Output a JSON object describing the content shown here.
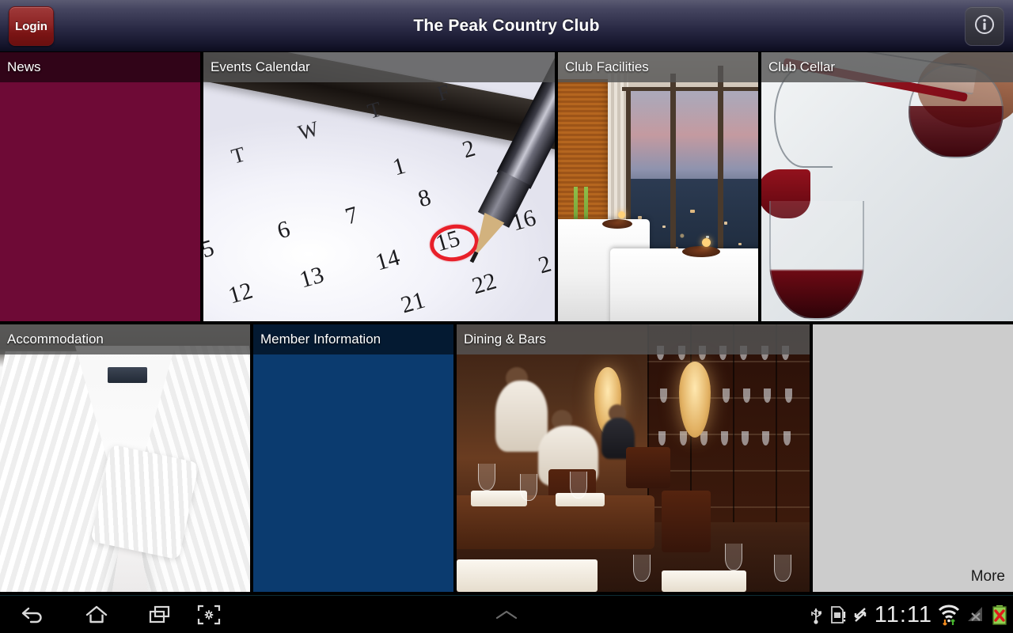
{
  "titlebar": {
    "title": "The Peak Country Club",
    "login_label": "Login",
    "info_icon": "info-circle-icon"
  },
  "tiles": [
    {
      "id": "news",
      "label": "News",
      "style": "flat-burgundy",
      "color": "#6e0a36",
      "header_color": "#2b0015",
      "artwork": "none"
    },
    {
      "id": "events",
      "label": "Events Calendar",
      "style": "photo",
      "artwork": "calendar-with-pen-circling-15"
    },
    {
      "id": "facilities",
      "label": "Club Facilities",
      "style": "photo",
      "artwork": "spa-treatment-room-city-skyline-at-dusk"
    },
    {
      "id": "cellar",
      "label": "Club Cellar",
      "style": "photo",
      "artwork": "red-wine-poured-from-decanter-into-glass"
    },
    {
      "id": "accom",
      "label": "Accommodation",
      "style": "photo",
      "artwork": "white-towelling-bathrobe"
    },
    {
      "id": "member",
      "label": "Member Information",
      "style": "flat-navy",
      "color": "#0b3b6f",
      "header_color": "#061a2e",
      "artwork": "none"
    },
    {
      "id": "dining",
      "label": "Dining & Bars",
      "style": "photo",
      "artwork": "restaurant-interior-set-tables-glass-cabinet"
    }
  ],
  "more_panel": {
    "label": "More",
    "background": "#cccccc"
  },
  "calendar_art": {
    "weekday_letters": [
      "T",
      "W",
      "T",
      "F"
    ],
    "dates": [
      "1",
      "2",
      "5",
      "6",
      "7",
      "8",
      "12",
      "13",
      "14",
      "15",
      "16",
      "21",
      "22",
      "2"
    ],
    "circled_date": "15",
    "circle_color": "#e8202a"
  },
  "systembar": {
    "nav": [
      {
        "name": "back-icon",
        "label": "Back"
      },
      {
        "name": "home-icon",
        "label": "Home"
      },
      {
        "name": "recents-icon",
        "label": "Recent apps"
      },
      {
        "name": "screenshot-icon",
        "label": "Screenshot"
      }
    ],
    "notification_handle": "chevron-up-icon",
    "clock": "11:11",
    "status_icons": [
      {
        "name": "usb-icon",
        "label": "USB connected"
      },
      {
        "name": "sim-card-alert-icon",
        "label": "No SIM card"
      },
      {
        "name": "sync-icon",
        "label": "Sync active"
      },
      {
        "name": "wifi-icon",
        "label": "Wi-Fi connected"
      },
      {
        "name": "cellular-signal-off-icon",
        "label": "No cellular signal"
      },
      {
        "name": "battery-error-icon",
        "label": "Battery error"
      }
    ]
  },
  "colors": {
    "titlebar_top": "#5a5a72",
    "titlebar_bottom": "#0d0d1e",
    "login_red": "#8d2525",
    "news_burgundy": "#6e0a36",
    "member_navy": "#0b3b6f",
    "caption_overlay": "rgba(84,84,84,.82)",
    "more_gray": "#cccccc",
    "system_black": "#000000"
  }
}
